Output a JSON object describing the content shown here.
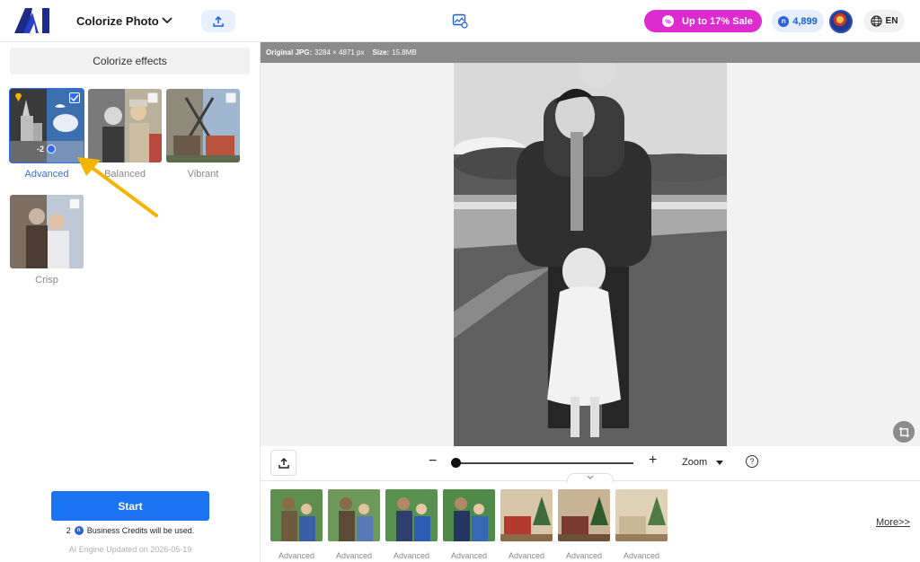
{
  "header": {
    "app_title": "Colorize Photo",
    "sale_label": "Up to 17% Sale",
    "credits": "4,899",
    "language": "EN"
  },
  "left_panel": {
    "section_title": "Colorize effects",
    "effects": [
      {
        "label": "Advanced",
        "selected": true,
        "cost": "-2"
      },
      {
        "label": "Balanced",
        "selected": false
      },
      {
        "label": "Vibrant",
        "selected": false
      },
      {
        "label": "Crisp",
        "selected": false
      }
    ],
    "start_label": "Start",
    "credits_prefix": "2",
    "credits_suffix": "Business Credits will be used.",
    "engine_note": "AI Engine Updated on 2026-05-19"
  },
  "main": {
    "info_format": "Original JPG:",
    "info_dimensions": "3284 × 4871 px",
    "info_size_label": "Size:",
    "info_size": "15.8MB",
    "zoom_label": "Zoom",
    "help_glyph": "?",
    "history": [
      {
        "label": "Advanced"
      },
      {
        "label": "Advanced"
      },
      {
        "label": "Advanced"
      },
      {
        "label": "Advanced"
      },
      {
        "label": "Advanced"
      },
      {
        "label": "Advanced"
      },
      {
        "label": "Advanced"
      }
    ],
    "more_label": "More>>"
  },
  "colors": {
    "accent": "#1a73f0",
    "sale": "#dd2bd0",
    "selection": "#2f6df0",
    "arrow": "#f4b400"
  }
}
